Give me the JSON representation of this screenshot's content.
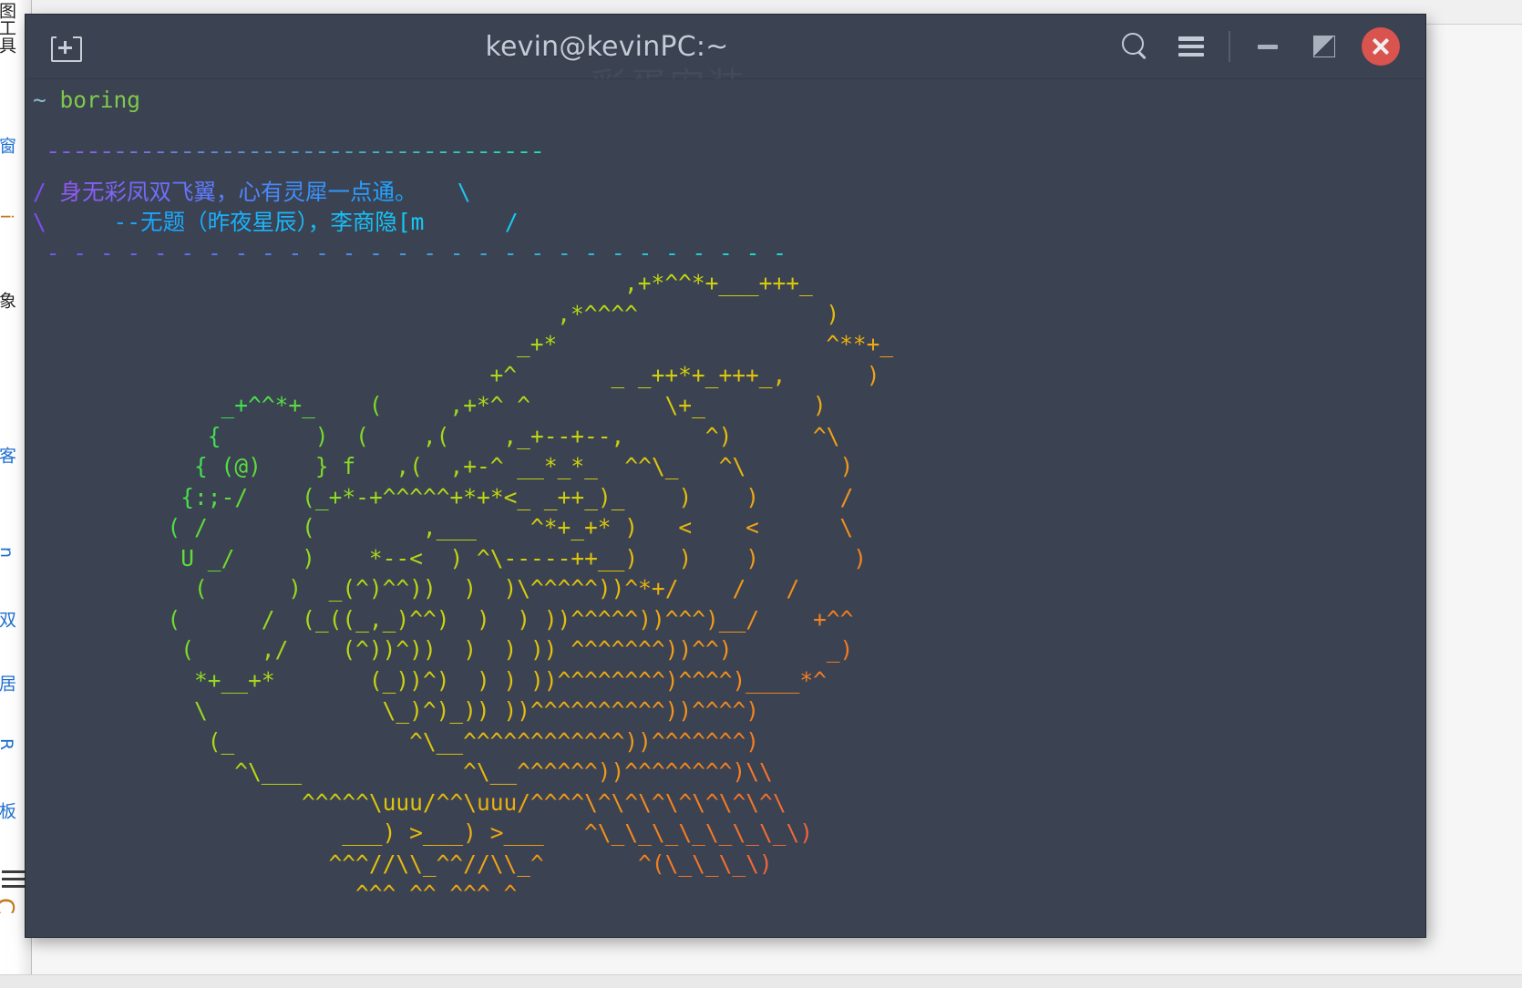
{
  "background": {
    "column_texts": [
      "图工具",
      "窗",
      "i",
      "象",
      "客",
      "n",
      "双",
      "居",
      "R",
      "板"
    ],
    "label": "underlying-application-window"
  },
  "titlebar": {
    "title": "kevin@kevinPC:~",
    "watermark": "彩蛋安装",
    "new_tab_label": "New Tab",
    "search_label": "Find",
    "menu_label": "Menu",
    "minimize_label": "Minimize",
    "maximize_label": "Maximize",
    "close_label": "Close",
    "bg_color": "#3b4252",
    "title_color": "#c3cbd6",
    "close_color": "#d9534f"
  },
  "terminal": {
    "bg_color": "#3b4252",
    "fg_color": "#d8dee9",
    "prompt_symbol": "~",
    "command": "boring",
    "prompt_color": "#88c0d0",
    "command_color": "#7ec94b",
    "final_prompt": "~",
    "cursor": "block",
    "poem": {
      "line1": "身无彩凤双飞翼，心有灵犀一点通。",
      "line2": "--无题（昨夜星辰），李商隐[m",
      "border_top": "¯¯¯¯¯¯¯¯¯¯¯¯¯¯¯¯¯¯¯¯¯¯¯¯¯¯¯¯¯¯¯¯¯¯¯¯¯",
      "border_bottom": "- - - - - - - - - - - - - - - - - - - - - - - - - - - -",
      "left1": "/",
      "right1": "\\",
      "left2": "\\",
      "right2": "/"
    },
    "art_lines": [
      "                                            ,+*^^*+___+++_",
      "                                       ,*^^^^              )",
      "                                    _+*                    ^**+_",
      "                                  +^       _ _++*+_+++_,      )",
      "              _+^^*+_    (     ,+*^ ^          \\+_        )",
      "             {       )  (    ,(    ,_+--+--,      ^)      ^\\",
      "            { (@)    } f   ,(  ,+-^ __*_*_  ^^\\_   ^\\       )",
      "           {:;-/    (_+*-+^^^^^+*+*<_ _++_)_    )    )      /",
      "          ( /       (        ,___    ^*+_+* )   <    <      \\",
      "           U _/     )    *--<  ) ^\\-----++__)   )    )       )",
      "            (      )  _(^)^^))  )  )\\^^^^^))^*+/    /   /",
      "          (      /  (_((_,_)^^)  )  ) ))^^^^^))^^^)__/    +^^",
      "           (     ,/    (^))^))  )  ) )) ^^^^^^^))^^)       _)",
      "            *+__+*       (_))^)  ) ) ))^^^^^^^^)^^^^)____*^",
      "            \\             \\_)^)_)) ))^^^^^^^^^^))^^^^)",
      "             (_             ^\\__^^^^^^^^^^^^))^^^^^^^)",
      "               ^\\___            ^\\__^^^^^^))^^^^^^^^)\\\\",
      "                    ^^^^^\\uuu/^^\\uuu/^^^^\\^\\^\\^\\^\\^\\^\\^\\",
      "                       ___) >___) >___   ^\\_\\_\\_\\_\\_\\_\\_\\)",
      "                      ^^^//\\\\_^^//\\\\_^       ^(\\_\\_\\_\\)",
      "                        ^^^ ^^ ^^^ ^"
    ],
    "art_gradient_stops": [
      "#19e0a0",
      "#1fe08c",
      "#36df5c",
      "#6fdb2d",
      "#a8d81b",
      "#c8d30f",
      "#e5bf0c",
      "#f19c18",
      "#f4801f",
      "#f0643a"
    ],
    "art_description": "lolcat rainbow-colored ASCII art sheep"
  }
}
